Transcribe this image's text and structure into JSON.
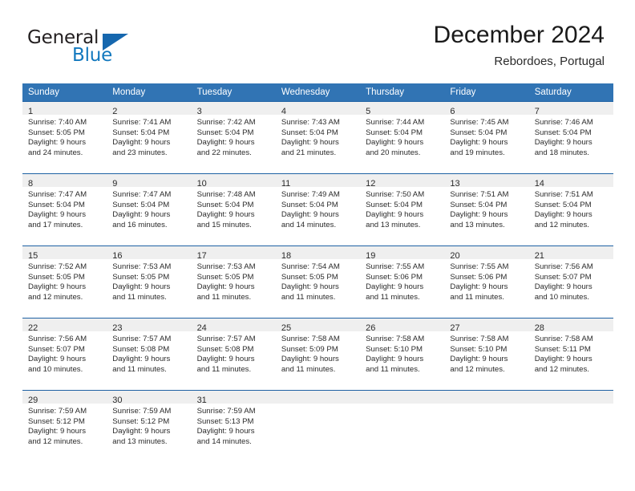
{
  "logo": {
    "word_top": "General",
    "word_bottom": "Blue",
    "triangle_color": "#1667ae"
  },
  "header": {
    "title": "December 2024",
    "location": "Rebordoes, Portugal",
    "header_bg": "#3174b4",
    "daynum_bg": "#efefef",
    "cell_border": "#1f62a4"
  },
  "weekday_headers": [
    "Sunday",
    "Monday",
    "Tuesday",
    "Wednesday",
    "Thursday",
    "Friday",
    "Saturday"
  ],
  "weeks": [
    [
      {
        "day": "1",
        "sunrise": "Sunrise: 7:40 AM",
        "sunset": "Sunset: 5:05 PM",
        "daylight1": "Daylight: 9 hours",
        "daylight2": "and 24 minutes."
      },
      {
        "day": "2",
        "sunrise": "Sunrise: 7:41 AM",
        "sunset": "Sunset: 5:04 PM",
        "daylight1": "Daylight: 9 hours",
        "daylight2": "and 23 minutes."
      },
      {
        "day": "3",
        "sunrise": "Sunrise: 7:42 AM",
        "sunset": "Sunset: 5:04 PM",
        "daylight1": "Daylight: 9 hours",
        "daylight2": "and 22 minutes."
      },
      {
        "day": "4",
        "sunrise": "Sunrise: 7:43 AM",
        "sunset": "Sunset: 5:04 PM",
        "daylight1": "Daylight: 9 hours",
        "daylight2": "and 21 minutes."
      },
      {
        "day": "5",
        "sunrise": "Sunrise: 7:44 AM",
        "sunset": "Sunset: 5:04 PM",
        "daylight1": "Daylight: 9 hours",
        "daylight2": "and 20 minutes."
      },
      {
        "day": "6",
        "sunrise": "Sunrise: 7:45 AM",
        "sunset": "Sunset: 5:04 PM",
        "daylight1": "Daylight: 9 hours",
        "daylight2": "and 19 minutes."
      },
      {
        "day": "7",
        "sunrise": "Sunrise: 7:46 AM",
        "sunset": "Sunset: 5:04 PM",
        "daylight1": "Daylight: 9 hours",
        "daylight2": "and 18 minutes."
      }
    ],
    [
      {
        "day": "8",
        "sunrise": "Sunrise: 7:47 AM",
        "sunset": "Sunset: 5:04 PM",
        "daylight1": "Daylight: 9 hours",
        "daylight2": "and 17 minutes."
      },
      {
        "day": "9",
        "sunrise": "Sunrise: 7:47 AM",
        "sunset": "Sunset: 5:04 PM",
        "daylight1": "Daylight: 9 hours",
        "daylight2": "and 16 minutes."
      },
      {
        "day": "10",
        "sunrise": "Sunrise: 7:48 AM",
        "sunset": "Sunset: 5:04 PM",
        "daylight1": "Daylight: 9 hours",
        "daylight2": "and 15 minutes."
      },
      {
        "day": "11",
        "sunrise": "Sunrise: 7:49 AM",
        "sunset": "Sunset: 5:04 PM",
        "daylight1": "Daylight: 9 hours",
        "daylight2": "and 14 minutes."
      },
      {
        "day": "12",
        "sunrise": "Sunrise: 7:50 AM",
        "sunset": "Sunset: 5:04 PM",
        "daylight1": "Daylight: 9 hours",
        "daylight2": "and 13 minutes."
      },
      {
        "day": "13",
        "sunrise": "Sunrise: 7:51 AM",
        "sunset": "Sunset: 5:04 PM",
        "daylight1": "Daylight: 9 hours",
        "daylight2": "and 13 minutes."
      },
      {
        "day": "14",
        "sunrise": "Sunrise: 7:51 AM",
        "sunset": "Sunset: 5:04 PM",
        "daylight1": "Daylight: 9 hours",
        "daylight2": "and 12 minutes."
      }
    ],
    [
      {
        "day": "15",
        "sunrise": "Sunrise: 7:52 AM",
        "sunset": "Sunset: 5:05 PM",
        "daylight1": "Daylight: 9 hours",
        "daylight2": "and 12 minutes."
      },
      {
        "day": "16",
        "sunrise": "Sunrise: 7:53 AM",
        "sunset": "Sunset: 5:05 PM",
        "daylight1": "Daylight: 9 hours",
        "daylight2": "and 11 minutes."
      },
      {
        "day": "17",
        "sunrise": "Sunrise: 7:53 AM",
        "sunset": "Sunset: 5:05 PM",
        "daylight1": "Daylight: 9 hours",
        "daylight2": "and 11 minutes."
      },
      {
        "day": "18",
        "sunrise": "Sunrise: 7:54 AM",
        "sunset": "Sunset: 5:05 PM",
        "daylight1": "Daylight: 9 hours",
        "daylight2": "and 11 minutes."
      },
      {
        "day": "19",
        "sunrise": "Sunrise: 7:55 AM",
        "sunset": "Sunset: 5:06 PM",
        "daylight1": "Daylight: 9 hours",
        "daylight2": "and 11 minutes."
      },
      {
        "day": "20",
        "sunrise": "Sunrise: 7:55 AM",
        "sunset": "Sunset: 5:06 PM",
        "daylight1": "Daylight: 9 hours",
        "daylight2": "and 11 minutes."
      },
      {
        "day": "21",
        "sunrise": "Sunrise: 7:56 AM",
        "sunset": "Sunset: 5:07 PM",
        "daylight1": "Daylight: 9 hours",
        "daylight2": "and 10 minutes."
      }
    ],
    [
      {
        "day": "22",
        "sunrise": "Sunrise: 7:56 AM",
        "sunset": "Sunset: 5:07 PM",
        "daylight1": "Daylight: 9 hours",
        "daylight2": "and 10 minutes."
      },
      {
        "day": "23",
        "sunrise": "Sunrise: 7:57 AM",
        "sunset": "Sunset: 5:08 PM",
        "daylight1": "Daylight: 9 hours",
        "daylight2": "and 11 minutes."
      },
      {
        "day": "24",
        "sunrise": "Sunrise: 7:57 AM",
        "sunset": "Sunset: 5:08 PM",
        "daylight1": "Daylight: 9 hours",
        "daylight2": "and 11 minutes."
      },
      {
        "day": "25",
        "sunrise": "Sunrise: 7:58 AM",
        "sunset": "Sunset: 5:09 PM",
        "daylight1": "Daylight: 9 hours",
        "daylight2": "and 11 minutes."
      },
      {
        "day": "26",
        "sunrise": "Sunrise: 7:58 AM",
        "sunset": "Sunset: 5:10 PM",
        "daylight1": "Daylight: 9 hours",
        "daylight2": "and 11 minutes."
      },
      {
        "day": "27",
        "sunrise": "Sunrise: 7:58 AM",
        "sunset": "Sunset: 5:10 PM",
        "daylight1": "Daylight: 9 hours",
        "daylight2": "and 12 minutes."
      },
      {
        "day": "28",
        "sunrise": "Sunrise: 7:58 AM",
        "sunset": "Sunset: 5:11 PM",
        "daylight1": "Daylight: 9 hours",
        "daylight2": "and 12 minutes."
      }
    ],
    [
      {
        "day": "29",
        "sunrise": "Sunrise: 7:59 AM",
        "sunset": "Sunset: 5:12 PM",
        "daylight1": "Daylight: 9 hours",
        "daylight2": "and 12 minutes."
      },
      {
        "day": "30",
        "sunrise": "Sunrise: 7:59 AM",
        "sunset": "Sunset: 5:12 PM",
        "daylight1": "Daylight: 9 hours",
        "daylight2": "and 13 minutes."
      },
      {
        "day": "31",
        "sunrise": "Sunrise: 7:59 AM",
        "sunset": "Sunset: 5:13 PM",
        "daylight1": "Daylight: 9 hours",
        "daylight2": "and 14 minutes."
      },
      {
        "day": "",
        "sunrise": "",
        "sunset": "",
        "daylight1": "",
        "daylight2": ""
      },
      {
        "day": "",
        "sunrise": "",
        "sunset": "",
        "daylight1": "",
        "daylight2": ""
      },
      {
        "day": "",
        "sunrise": "",
        "sunset": "",
        "daylight1": "",
        "daylight2": ""
      },
      {
        "day": "",
        "sunrise": "",
        "sunset": "",
        "daylight1": "",
        "daylight2": ""
      }
    ]
  ]
}
